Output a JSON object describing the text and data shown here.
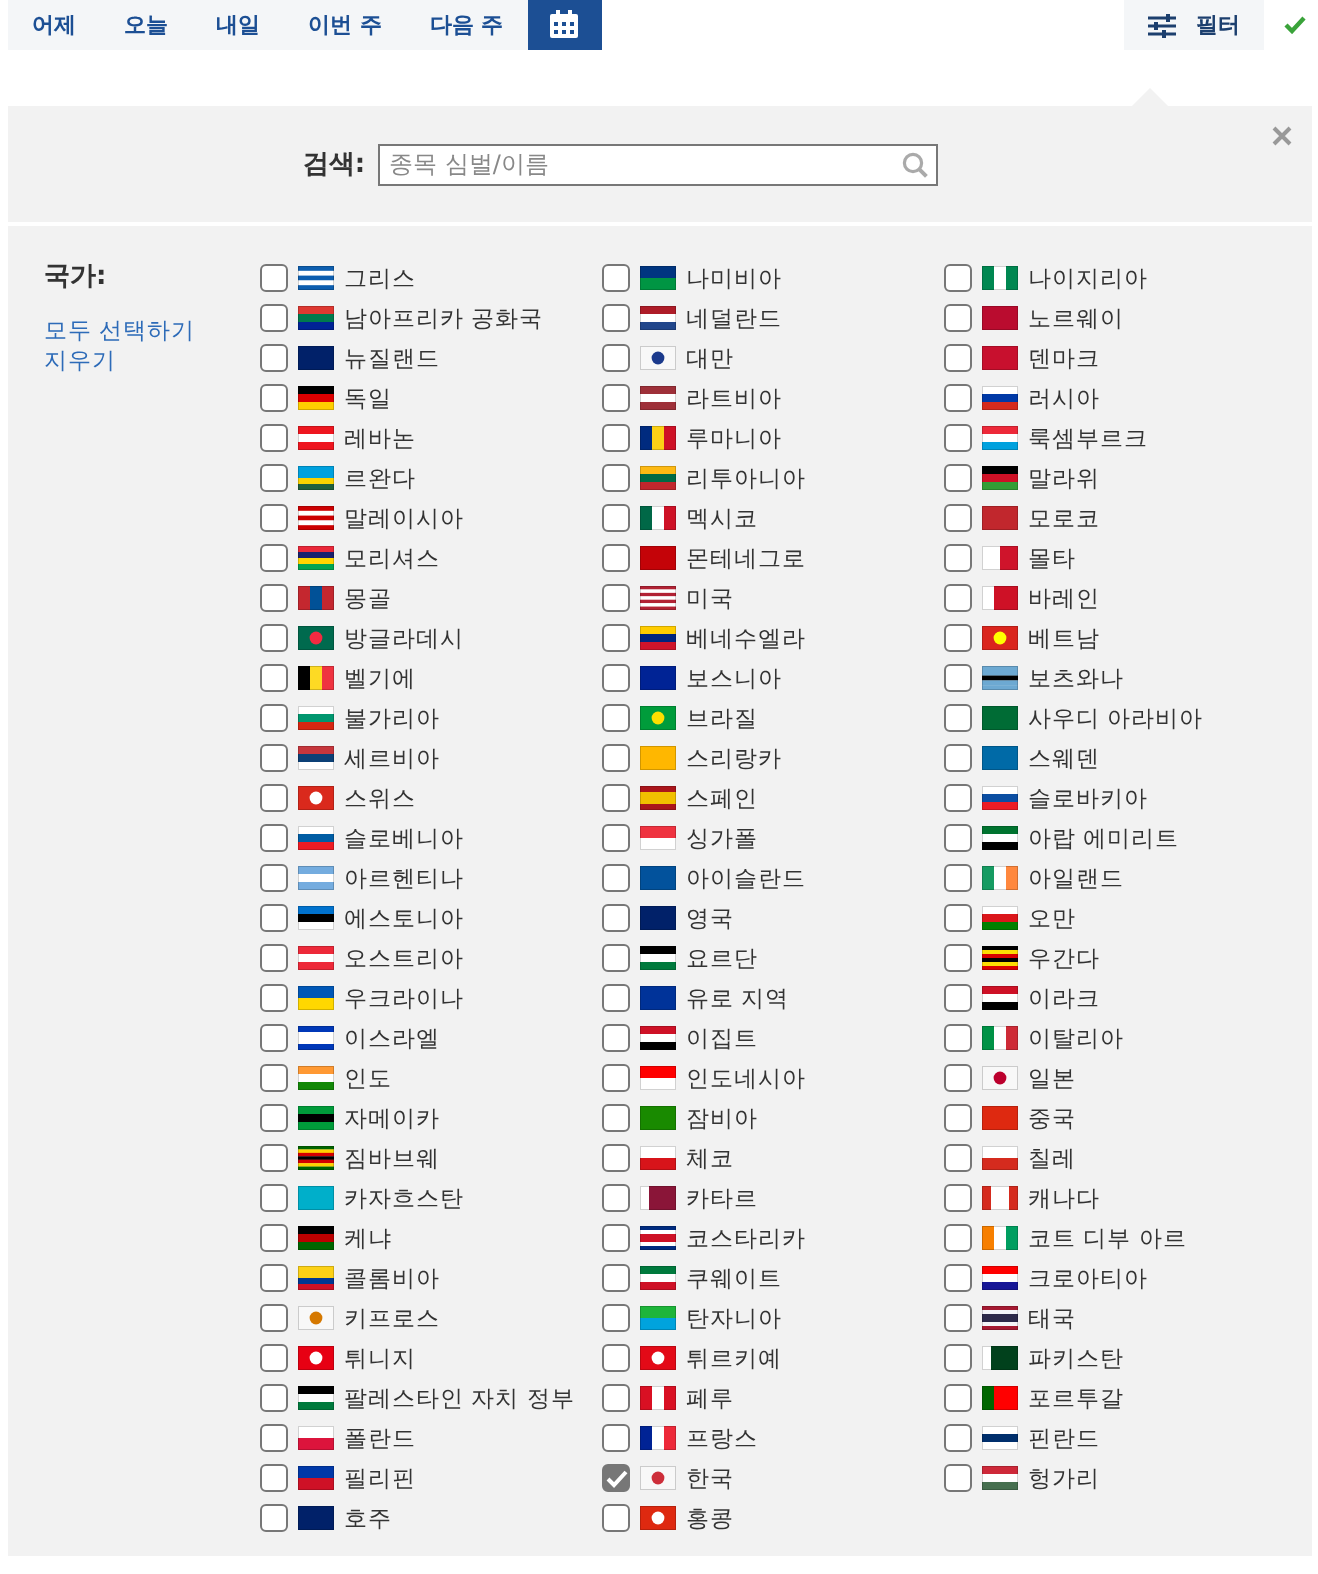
{
  "tabs": [
    {
      "label": "어제",
      "kind": "text",
      "selected": false
    },
    {
      "label": "오늘",
      "kind": "text",
      "selected": false
    },
    {
      "label": "내일",
      "kind": "text",
      "selected": false
    },
    {
      "label": "이번 주",
      "kind": "text",
      "selected": false
    },
    {
      "label": "다음 주",
      "kind": "text",
      "selected": false
    },
    {
      "kind": "calendar",
      "selected": true
    }
  ],
  "filter_button": {
    "label": "필터"
  },
  "search": {
    "label": "검색:",
    "placeholder": "종목 심벌/이름"
  },
  "country_filter": {
    "label": "국가:",
    "links": [
      "모두 선택하기",
      "지우기"
    ],
    "columns": [
      [
        {
          "label": "그리스",
          "checked": false
        },
        {
          "label": "남아프리카 공화국",
          "checked": false
        },
        {
          "label": "뉴질랜드",
          "checked": false
        },
        {
          "label": "독일",
          "checked": false
        },
        {
          "label": "레바논",
          "checked": false
        },
        {
          "label": "르완다",
          "checked": false
        },
        {
          "label": "말레이시아",
          "checked": false
        },
        {
          "label": "모리셔스",
          "checked": false
        },
        {
          "label": "몽골",
          "checked": false
        },
        {
          "label": "방글라데시",
          "checked": false
        },
        {
          "label": "벨기에",
          "checked": false
        },
        {
          "label": "불가리아",
          "checked": false
        },
        {
          "label": "세르비아",
          "checked": false
        },
        {
          "label": "스위스",
          "checked": false
        },
        {
          "label": "슬로베니아",
          "checked": false
        },
        {
          "label": "아르헨티나",
          "checked": false
        },
        {
          "label": "에스토니아",
          "checked": false
        },
        {
          "label": "오스트리아",
          "checked": false
        },
        {
          "label": "우크라이나",
          "checked": false
        },
        {
          "label": "이스라엘",
          "checked": false
        },
        {
          "label": "인도",
          "checked": false
        },
        {
          "label": "자메이카",
          "checked": false
        },
        {
          "label": "짐바브웨",
          "checked": false
        },
        {
          "label": "카자흐스탄",
          "checked": false
        },
        {
          "label": "케냐",
          "checked": false
        },
        {
          "label": "콜롬비아",
          "checked": false
        },
        {
          "label": "키프로스",
          "checked": false
        },
        {
          "label": "튀니지",
          "checked": false
        },
        {
          "label": "팔레스타인 자치 정부",
          "checked": false
        },
        {
          "label": "폴란드",
          "checked": false
        },
        {
          "label": "필리핀",
          "checked": false
        },
        {
          "label": "호주",
          "checked": false
        }
      ],
      [
        {
          "label": "나미비아",
          "checked": false
        },
        {
          "label": "네덜란드",
          "checked": false
        },
        {
          "label": "대만",
          "checked": false
        },
        {
          "label": "라트비아",
          "checked": false
        },
        {
          "label": "루마니아",
          "checked": false
        },
        {
          "label": "리투아니아",
          "checked": false
        },
        {
          "label": "멕시코",
          "checked": false
        },
        {
          "label": "몬테네그로",
          "checked": false
        },
        {
          "label": "미국",
          "checked": false
        },
        {
          "label": "베네수엘라",
          "checked": false
        },
        {
          "label": "보스니아",
          "checked": false
        },
        {
          "label": "브라질",
          "checked": false
        },
        {
          "label": "스리랑카",
          "checked": false
        },
        {
          "label": "스페인",
          "checked": false
        },
        {
          "label": "싱가폴",
          "checked": false
        },
        {
          "label": "아이슬란드",
          "checked": false
        },
        {
          "label": "영국",
          "checked": false
        },
        {
          "label": "요르단",
          "checked": false
        },
        {
          "label": "유로 지역",
          "checked": false
        },
        {
          "label": "이집트",
          "checked": false
        },
        {
          "label": "인도네시아",
          "checked": false
        },
        {
          "label": "잠비아",
          "checked": false
        },
        {
          "label": "체코",
          "checked": false
        },
        {
          "label": "카타르",
          "checked": false
        },
        {
          "label": "코스타리카",
          "checked": false
        },
        {
          "label": "쿠웨이트",
          "checked": false
        },
        {
          "label": "탄자니아",
          "checked": false
        },
        {
          "label": "튀르키예",
          "checked": false
        },
        {
          "label": "페루",
          "checked": false
        },
        {
          "label": "프랑스",
          "checked": false
        },
        {
          "label": "한국",
          "checked": true
        },
        {
          "label": "홍콩",
          "checked": false
        }
      ],
      [
        {
          "label": "나이지리아",
          "checked": false
        },
        {
          "label": "노르웨이",
          "checked": false
        },
        {
          "label": "덴마크",
          "checked": false
        },
        {
          "label": "러시아",
          "checked": false
        },
        {
          "label": "룩셈부르크",
          "checked": false
        },
        {
          "label": "말라위",
          "checked": false
        },
        {
          "label": "모로코",
          "checked": false
        },
        {
          "label": "몰타",
          "checked": false
        },
        {
          "label": "바레인",
          "checked": false
        },
        {
          "label": "베트남",
          "checked": false
        },
        {
          "label": "보츠와나",
          "checked": false
        },
        {
          "label": "사우디 아라비아",
          "checked": false
        },
        {
          "label": "스웨덴",
          "checked": false
        },
        {
          "label": "슬로바키아",
          "checked": false
        },
        {
          "label": "아랍 에미리트",
          "checked": false
        },
        {
          "label": "아일랜드",
          "checked": false
        },
        {
          "label": "오만",
          "checked": false
        },
        {
          "label": "우간다",
          "checked": false
        },
        {
          "label": "이라크",
          "checked": false
        },
        {
          "label": "이탈리아",
          "checked": false
        },
        {
          "label": "일본",
          "checked": false
        },
        {
          "label": "중국",
          "checked": false
        },
        {
          "label": "칠레",
          "checked": false
        },
        {
          "label": "캐나다",
          "checked": false
        },
        {
          "label": "코트 디부 아르",
          "checked": false
        },
        {
          "label": "크로아티아",
          "checked": false
        },
        {
          "label": "태국",
          "checked": false
        },
        {
          "label": "파키스탄",
          "checked": false
        },
        {
          "label": "포르투갈",
          "checked": false
        },
        {
          "label": "핀란드",
          "checked": false
        },
        {
          "label": "헝가리",
          "checked": false
        }
      ]
    ]
  }
}
